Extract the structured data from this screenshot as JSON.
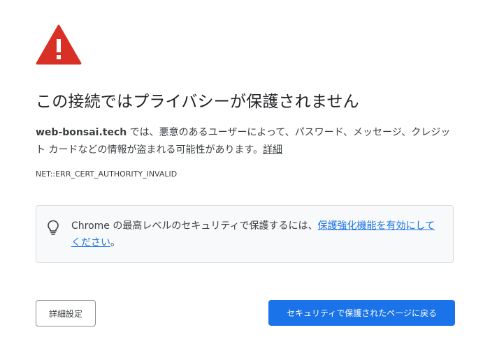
{
  "page": {
    "title": "この接続ではプライバシーが保護されません",
    "domain": "web-bonsai.tech",
    "description_rest": " では、悪意のあるユーザーによって、パスワード、メッセージ、クレジット カードなどの情報が盗まれる可能性があります。",
    "details_link": "詳細",
    "error_code": "NET::ERR_CERT_AUTHORITY_INVALID"
  },
  "info_box": {
    "text": "Chrome の最高レベルのセキュリティで保護するには、",
    "link": "保護強化機能を有効にしてください",
    "suffix": "。"
  },
  "buttons": {
    "advanced_label": "詳細設定",
    "back_label": "セキュリティで保護されたページに戻る"
  },
  "icons": {
    "warning": "warning-triangle-icon",
    "bulb": "lightbulb-icon"
  },
  "colors": {
    "warning_red": "#d93025",
    "link_blue": "#1a73e8",
    "primary_button": "#1a73e8"
  }
}
